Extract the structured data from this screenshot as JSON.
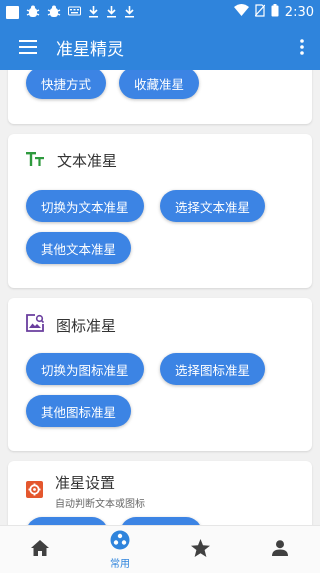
{
  "status_bar": {
    "time": "2:30"
  },
  "app_bar": {
    "title": "准星精灵"
  },
  "cards": {
    "top": {
      "buttons": [
        "快捷方式",
        "收藏准星"
      ]
    },
    "text": {
      "title": "文本准星",
      "buttons": [
        "切换为文本准星",
        "选择文本准星",
        "其他文本准星"
      ]
    },
    "image": {
      "title": "图标准星",
      "buttons": [
        "切换为图标准星",
        "选择图标准星",
        "其他图标准星"
      ]
    },
    "settings": {
      "title": "准星设置",
      "subtitle": "自动判断文本或图标"
    }
  },
  "bottom_nav": {
    "active_label": "常用"
  },
  "colors": {
    "primary": "#2f84dc",
    "button": "#3c84e4",
    "text_icon": "#2e9a3e",
    "image_icon": "#6a3e9e",
    "settings_icon": "#e4572e"
  }
}
